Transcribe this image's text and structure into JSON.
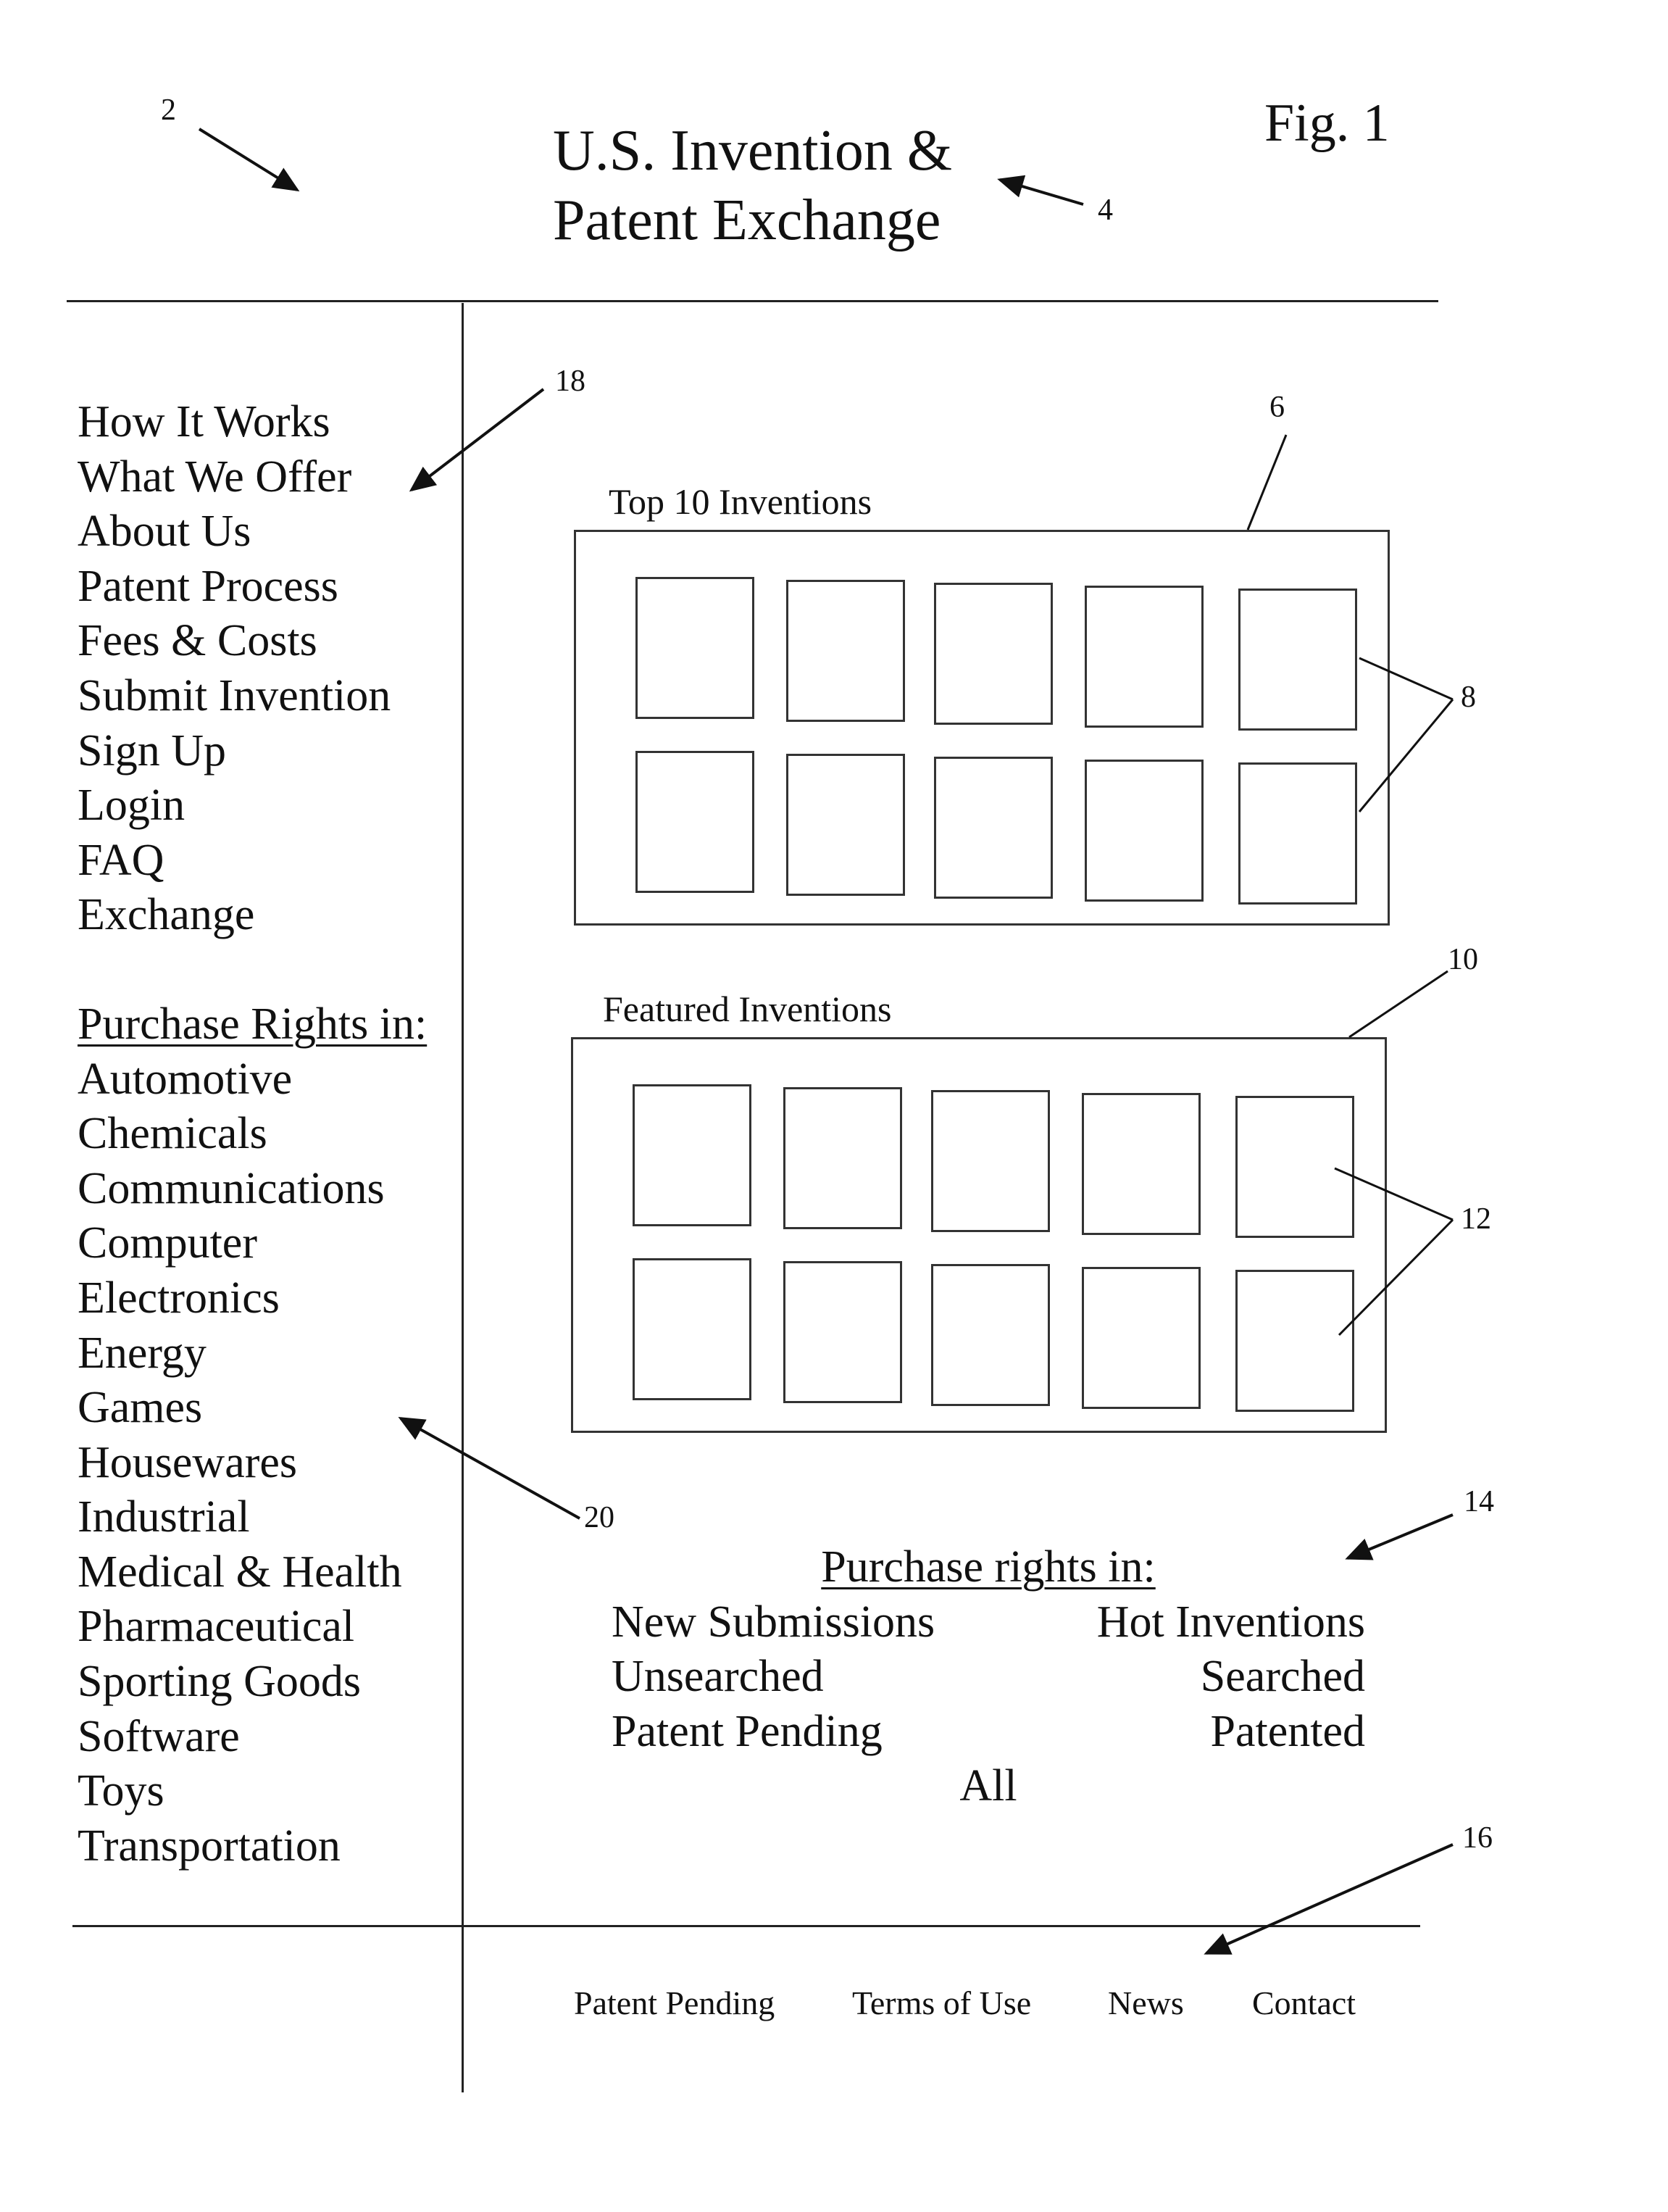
{
  "figure": {
    "label": "Fig. 1",
    "title_line1": "U.S. Invention &",
    "title_line2": "Patent Exchange"
  },
  "reference_numerals": {
    "page": "2",
    "title": "4",
    "top10_panel": "6",
    "top10_items": "8",
    "featured_panel": "10",
    "featured_items": "12",
    "purchase_rights_section": "14",
    "footer_links": "16",
    "nav_menu": "18",
    "category_menu": "20"
  },
  "sidebar": {
    "nav_items": [
      "How It Works",
      "What We Offer",
      "About Us",
      "Patent Process",
      "Fees & Costs",
      "Submit Invention",
      "Sign Up",
      "Login",
      "FAQ",
      "Exchange"
    ],
    "categories_heading": "Purchase Rights in:",
    "categories": [
      "Automotive",
      "Chemicals",
      "Communications",
      "Computer",
      "Electronics",
      "Energy",
      "Games",
      "Housewares",
      "Industrial",
      "Medical & Health",
      "Pharmaceutical",
      "Sporting Goods",
      "Software",
      "Toys",
      "Transportation"
    ]
  },
  "main": {
    "top10": {
      "title": "Top 10 Inventions",
      "item_count": 10
    },
    "featured": {
      "title": "Featured Inventions",
      "item_count": 10
    },
    "purchase_rights": {
      "heading": "Purchase rights in:",
      "rows": [
        {
          "left": "New Submissions",
          "right": "Hot Inventions"
        },
        {
          "left": "Unsearched",
          "right": "Searched"
        },
        {
          "left": "Patent Pending",
          "right": "Patented"
        }
      ],
      "all": "All"
    }
  },
  "footer": {
    "links": [
      "Patent Pending",
      "Terms of Use",
      "News",
      "Contact"
    ]
  }
}
